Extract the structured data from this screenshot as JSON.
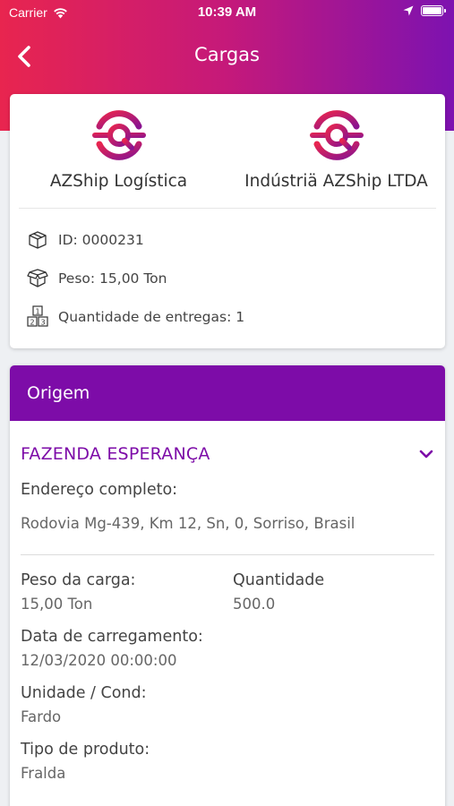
{
  "status_bar": {
    "carrier": "Carrier",
    "time": "10:39 AM"
  },
  "nav": {
    "title": "Cargas",
    "back_icon": "chevron-left-icon"
  },
  "companies": [
    {
      "name": "AZShip Logística",
      "logo": "azship-logo"
    },
    {
      "name": "Indústriä AZShip LTDA",
      "logo": "azship-logo"
    }
  ],
  "cargo_info": {
    "id": "ID: 0000231",
    "weight": "Peso: 15,00 Ton",
    "deliveries": "Quantidade de entregas: 1"
  },
  "origin": {
    "header": "Origem",
    "place": "FAZENDA ESPERANÇA",
    "address_label": "Endereço completo:",
    "address_value": "Rodovia Mg-439, Km 12, Sn, 0, Sorriso, Brasil",
    "weight_label": "Peso da carga:",
    "weight_value": "15,00 Ton",
    "quantity_label": "Quantidade",
    "quantity_value": "500.0",
    "loading_date_label": "Data de carregamento:",
    "loading_date_value": "12/03/2020 00:00:00",
    "unit_label": "Unidade / Cond:",
    "unit_value": "Fardo",
    "product_label": "Tipo de produto:",
    "product_value": "Fralda"
  },
  "colors": {
    "accent_purple": "#7d0ca8",
    "gradient_start": "#e8254f",
    "gradient_end": "#7d12b0"
  }
}
